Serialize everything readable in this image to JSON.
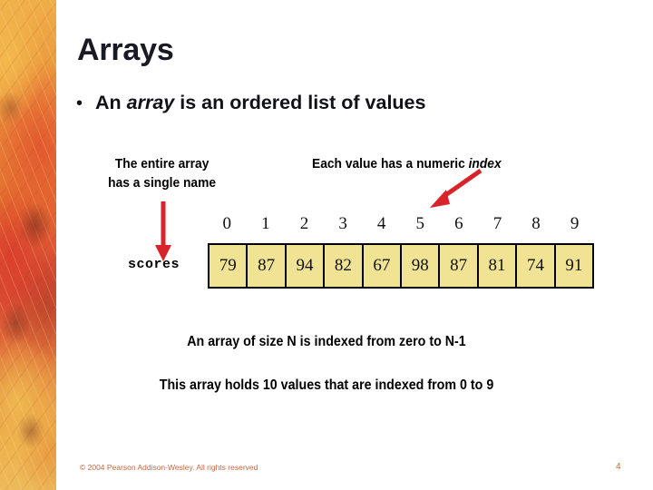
{
  "slide": {
    "title": "Arrays",
    "bullet": {
      "marker": "•",
      "text_before": "An ",
      "text_italic": "array",
      "text_after": " is an ordered list of values"
    },
    "callouts": {
      "left_line1": "The entire array",
      "left_line2": "has a single name",
      "right_before": "Each value has a numeric ",
      "right_italic": "index"
    },
    "array": {
      "name": "scores",
      "indices": [
        "0",
        "1",
        "2",
        "3",
        "4",
        "5",
        "6",
        "7",
        "8",
        "9"
      ],
      "values": [
        "79",
        "87",
        "94",
        "82",
        "67",
        "98",
        "87",
        "81",
        "74",
        "91"
      ],
      "cell_fill": "#f0e394",
      "cell_border": "#000000"
    },
    "notes": [
      "An array of size N is indexed from zero to N-1",
      "This array holds 10 values that are indexed from 0 to 9"
    ],
    "arrows": {
      "down_color": "#d8232a",
      "diagonal_color": "#d8232a",
      "down_name": "array-name-arrow",
      "diagonal_name": "index-pointer-arrow"
    },
    "footer": {
      "copyright": "© 2004 Pearson Addison-Wesley. All rights reserved",
      "page_number": "4",
      "color": "#c06a3e"
    },
    "decoration": {
      "left_strip": "autumn-leaves-image"
    }
  }
}
